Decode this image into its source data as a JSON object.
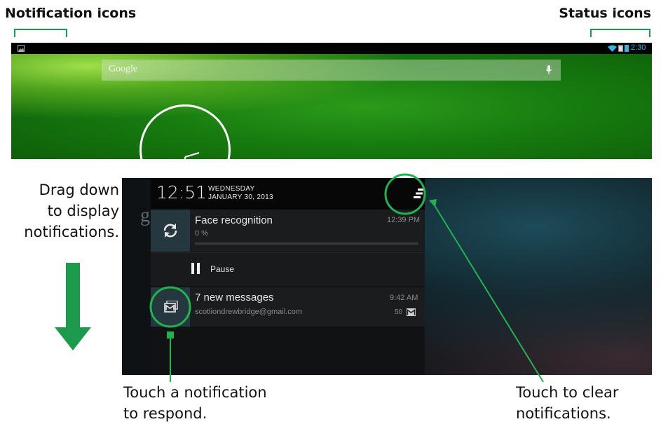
{
  "colors": {
    "accent": "#1e9a4d",
    "highlight_ring": "#21b34e",
    "wallpaper": "#1a8012"
  },
  "headings": {
    "notification_icons": "Notification icons",
    "status_icons": "Status icons"
  },
  "statusbar": {
    "time": "2:30",
    "icons": [
      "wifi-icon",
      "signal-icon",
      "battery-icon"
    ],
    "left_icon": "image-icon"
  },
  "home": {
    "search_label": "Google",
    "search_icon": "mic-icon"
  },
  "shade": {
    "background_letter": "g",
    "time": "12:51",
    "day": "WEDNESDAY",
    "date": "JANUARY 30, 2013",
    "notifications": [
      {
        "icon": "sync-icon",
        "title": "Face recognition",
        "subtitle": "0 %",
        "time": "12:39 PM",
        "progress": 0,
        "action": {
          "icon": "pause-icon",
          "label": "Pause"
        }
      },
      {
        "icon": "gmail-icon",
        "title": "7 new messages",
        "subtitle": "scotliondrewbridge@gmail.com",
        "time": "9:42 AM",
        "count": "50",
        "count_icon": "mail-icon"
      }
    ],
    "clear_icon": "clear-all-icon"
  },
  "captions": {
    "drag": [
      "Drag down",
      "to display",
      "notifications."
    ],
    "touch_notification": [
      "Touch a notification",
      "to respond."
    ],
    "touch_clear": [
      "Touch to clear",
      "notifications."
    ]
  }
}
